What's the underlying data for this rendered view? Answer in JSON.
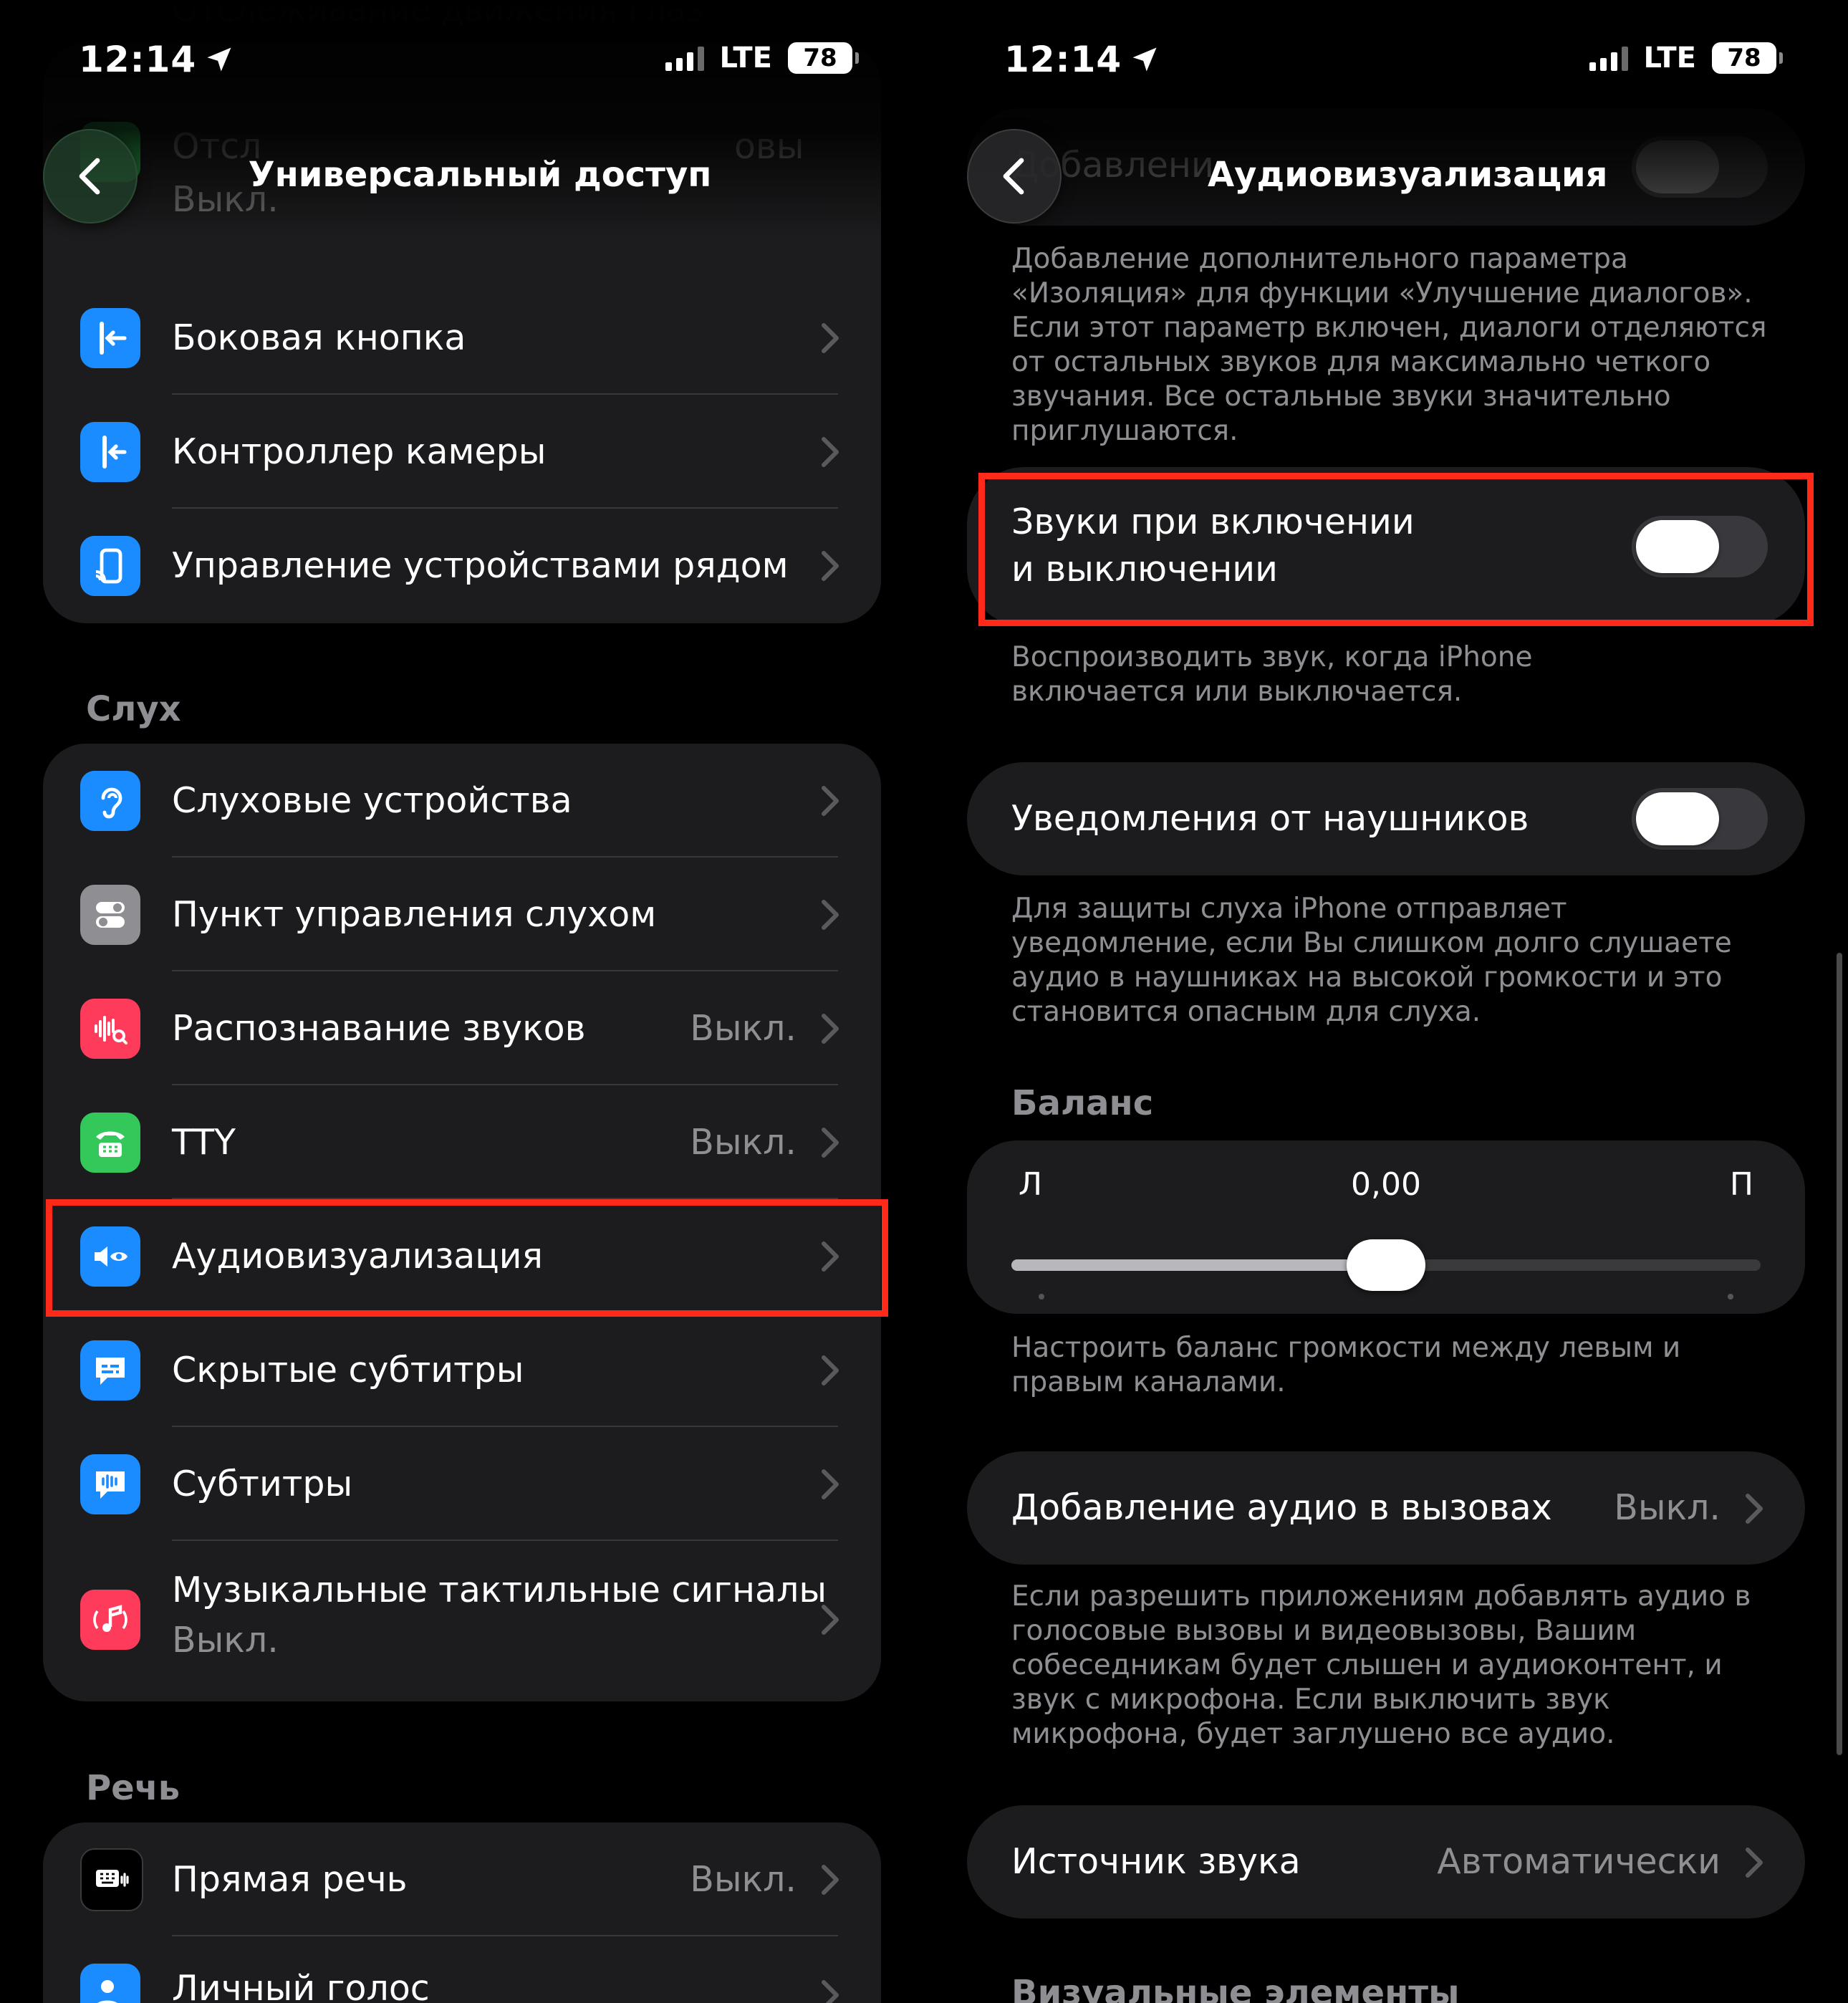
{
  "status": {
    "time": "12:14",
    "network": "LTE",
    "battery": "78"
  },
  "left": {
    "title": "Универсальный доступ",
    "top_ghost": {
      "label_prefix": "Отсл",
      "label_suffix": "овы",
      "value": "Выкл."
    },
    "top_partial": "Отслеживание движения глаз",
    "group1": [
      {
        "label": "Боковая кнопка",
        "icon": "side-button-icon",
        "color": "#1a8cff"
      },
      {
        "label": "Контроллер камеры",
        "icon": "camera-control-icon",
        "color": "#1a8cff"
      },
      {
        "label": "Управление устройствами рядом",
        "icon": "nearby-devices-icon",
        "color": "#1a8cff"
      }
    ],
    "section_hearing": "Слух",
    "group2": [
      {
        "label": "Слуховые устройства",
        "icon": "ear-icon",
        "color": "#1a8cff",
        "value": ""
      },
      {
        "label": "Пункт управления слухом",
        "icon": "toggles-icon",
        "color": "#8e8e93",
        "value": ""
      },
      {
        "label": "Распознавание звуков",
        "icon": "sound-recognition-icon",
        "color": "#ff3b5c",
        "value": "Выкл."
      },
      {
        "label": "TTY",
        "icon": "tty-icon",
        "color": "#34c759",
        "value": "Выкл."
      },
      {
        "label": "Аудиовизуализация",
        "icon": "audio-visual-icon",
        "color": "#1a8cff",
        "value": ""
      },
      {
        "label": "Скрытые субтитры",
        "icon": "subtitles-icon",
        "color": "#1a8cff",
        "value": ""
      },
      {
        "label": "Субтитры",
        "icon": "live-captions-icon",
        "color": "#1a8cff",
        "value": ""
      }
    ],
    "music_haptics": {
      "label": "Музыкальные тактильные сигналы",
      "sub": "Выкл.",
      "icon": "music-haptics-icon",
      "color": "#ff3b5c"
    },
    "section_speech": "Речь",
    "group3": [
      {
        "label": "Прямая речь",
        "icon": "keyboard-icon",
        "color": "#1c1c1e",
        "value": "Выкл."
      },
      {
        "label": "Личный голос",
        "icon": "person-icon",
        "color": "#1a8cff",
        "value": ""
      }
    ]
  },
  "right": {
    "title": "Аудиовизуализация",
    "ghost_label": "Добавлени",
    "isolation_note": "Добавление дополнительного параметра «Изоляция» для функции «Улучшение диалогов». Если этот параметр включен, диалоги отделяются от остальных звуков для максимально четкого звучания. Все остальные звуки значительно приглушаются.",
    "power_sounds": {
      "label_line1": "Звуки при включении",
      "label_line2": "и выключении",
      "on": false
    },
    "power_note": "Воспроизводить звук, когда iPhone включается или выключается.",
    "headphone_notif": {
      "label": "Уведомления от наушников",
      "on": false
    },
    "headphone_note": "Для защиты слуха iPhone отправляет уведомление, если Вы слишком долго слушаете аудио в наушниках на высокой громкости и это становится опасным для слуха.",
    "balance": {
      "title": "Баланс",
      "left": "Л",
      "right": "П",
      "value": "0,00",
      "position": 0.5
    },
    "balance_note": "Настроить баланс громкости между левым и правым каналами.",
    "call_audio": {
      "label": "Добавление аудио в вызовах",
      "value": "Выкл."
    },
    "call_note": "Если разрешить приложениям добавлять аудио в голосовые вызовы и видеовызовы, Вашим собеседникам будет слышен и аудиоконтент, и звук с микрофона. Если выключить звук микрофона, будет заглушено все аудио.",
    "sound_source": {
      "label": "Источник звука",
      "value": "Автоматически"
    },
    "bottom_partial": "Визуальные элементы"
  }
}
